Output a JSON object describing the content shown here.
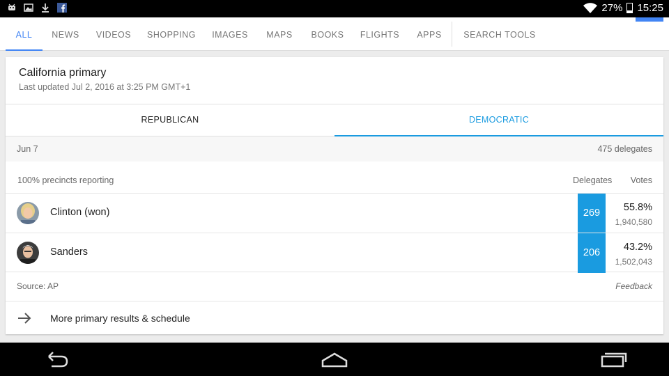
{
  "status_bar": {
    "battery_percent": "27%",
    "time": "15:25",
    "battery_level": 0.27,
    "icons": [
      "usb-debug-icon",
      "image-icon",
      "download-icon",
      "facebook-icon",
      "wifi-icon",
      "battery-icon"
    ]
  },
  "search_tabs": [
    {
      "label": "ALL",
      "active": true
    },
    {
      "label": "NEWS"
    },
    {
      "label": "VIDEOS"
    },
    {
      "label": "SHOPPING"
    },
    {
      "label": "IMAGES"
    },
    {
      "label": "MAPS"
    },
    {
      "label": "BOOKS"
    },
    {
      "label": "FLIGHTS"
    },
    {
      "label": "APPS"
    },
    {
      "label": "SEARCH TOOLS"
    }
  ],
  "card": {
    "title": "California primary",
    "subtitle": "Last updated Jul 2, 2016 at 3:25 PM GMT+1",
    "party_tabs": {
      "republican": "REPUBLICAN",
      "democratic": "DEMOCRATIC",
      "selected": "DEMOCRATIC"
    },
    "date": "Jun 7",
    "delegates_total": "475 delegates",
    "reporting": "100% precincts reporting",
    "col_delegates": "Delegates",
    "col_votes": "Votes",
    "candidates": [
      {
        "name": "Clinton (won)",
        "delegates": "269",
        "pct": "55.8%",
        "votes": "1,940,580"
      },
      {
        "name": "Sanders",
        "delegates": "206",
        "pct": "43.2%",
        "votes": "1,502,043"
      }
    ],
    "source": "Source: AP",
    "feedback": "Feedback",
    "more_link": "More primary results & schedule"
  },
  "colors": {
    "accent_blue": "#4285f4",
    "delegate_blue": "#1a9be0"
  }
}
